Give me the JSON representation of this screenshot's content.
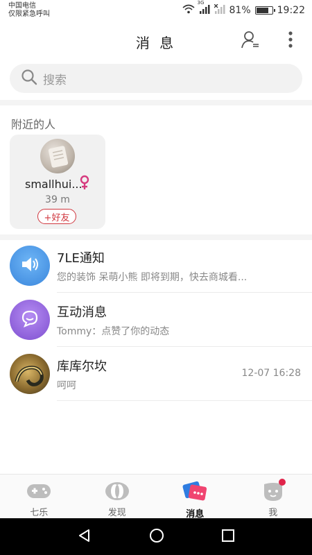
{
  "status_bar": {
    "carrier": "中国电信",
    "emergency": "仅限紧急呼叫",
    "network": "3G",
    "battery": "81%",
    "battery_level": 0.81,
    "time": "19:22"
  },
  "header": {
    "title": "消 息",
    "contacts_icon": "contacts-icon",
    "more_icon": "more-vertical-icon"
  },
  "search": {
    "placeholder": "搜索",
    "icon": "search-icon"
  },
  "nearby": {
    "section_title": "附近的人",
    "people": [
      {
        "name": "smallhui...",
        "gender": "female",
        "distance": "39 m",
        "add_label": "+好友"
      }
    ]
  },
  "messages": [
    {
      "title": "7LE通知",
      "subtitle": "您的装饰 呆萌小熊 即将到期，快去商城看...",
      "time": "",
      "icon": "speaker-icon",
      "color": "#4a90e2"
    },
    {
      "title": "互动消息",
      "subtitle": "Tommy：点赞了你的动态",
      "time": "",
      "icon": "chat-bubble-icon",
      "color": "#8a5ad6"
    },
    {
      "title": "库库尔坎",
      "subtitle": "呵呵",
      "time": "12-07 16:28",
      "icon": "avatar",
      "color": ""
    }
  ],
  "bottom_nav": [
    {
      "label": "七乐",
      "icon": "gamepad-icon",
      "active": false
    },
    {
      "label": "发现",
      "icon": "discover-icon",
      "active": false
    },
    {
      "label": "消息",
      "icon": "messages-icon",
      "active": true
    },
    {
      "label": "我",
      "icon": "profile-face-icon",
      "active": false,
      "badge": true
    }
  ],
  "colors": {
    "accent": "#d0363e",
    "badge": "#e0244a",
    "female": "#d63a7e"
  }
}
